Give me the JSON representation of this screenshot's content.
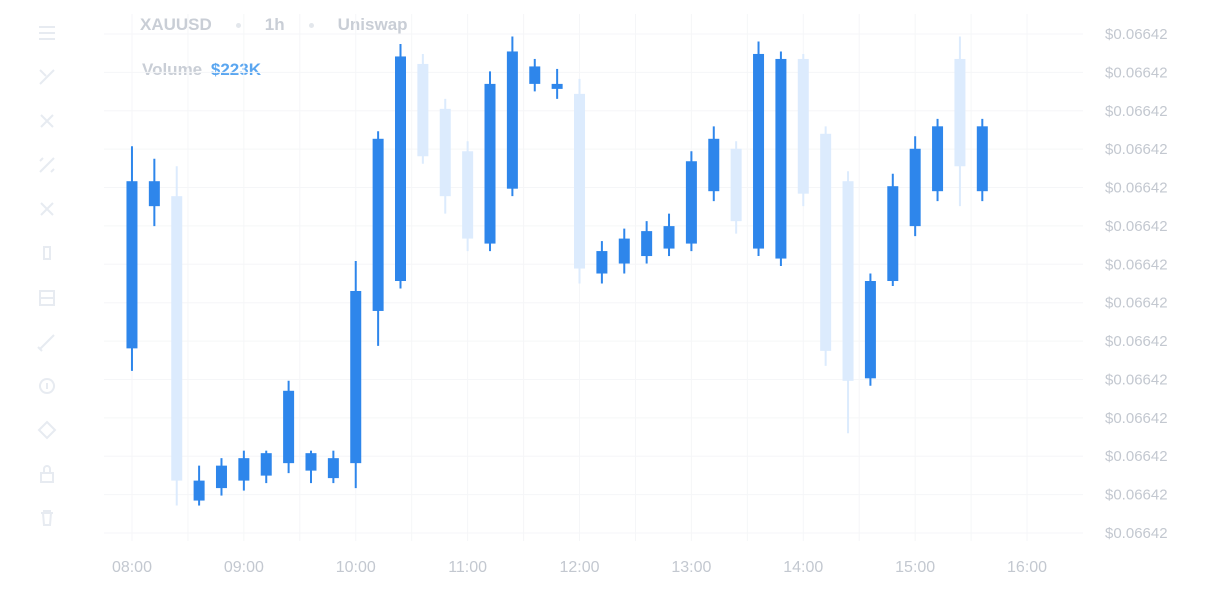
{
  "header": {
    "symbol": "XAUUSD",
    "interval": "1h",
    "exchange": "Uniswap"
  },
  "volume": {
    "label": "Volume",
    "value": "$223K"
  },
  "toolbar": {
    "icons": [
      "menu-icon",
      "cursor-icon",
      "crosshair-icon",
      "measure-icon",
      "fib-icon",
      "rectangle-icon",
      "text-icon",
      "pencil-icon",
      "magnet-icon",
      "brush-icon",
      "lock-icon",
      "trash-icon"
    ]
  },
  "colors": {
    "up": "#2e86eb",
    "down": "#dcebfd",
    "grid": "#f5f6f8",
    "label": "#c3c8d0"
  },
  "chart_data": {
    "type": "candlestick",
    "y_tick_labels": [
      "$0.06642",
      "$0.06642",
      "$0.06642",
      "$0.06642",
      "$0.06642",
      "$0.06642",
      "$0.06642",
      "$0.06642",
      "$0.06642",
      "$0.06642",
      "$0.06642",
      "$0.06642",
      "$0.06642",
      "$0.06642"
    ],
    "x_tick_labels": [
      "08:00",
      "09:00",
      "10:00",
      "11:00",
      "12:00",
      "13:00",
      "14:00",
      "15:00",
      "16:00"
    ],
    "x_range_hours": [
      7.75,
      16.5
    ],
    "y_range": [
      0,
      1
    ],
    "grid": true,
    "candles": [
      {
        "t": 8.0,
        "o": 0.37,
        "h": 0.775,
        "l": 0.325,
        "c": 0.705,
        "dir": "up"
      },
      {
        "t": 8.2,
        "o": 0.655,
        "h": 0.75,
        "l": 0.615,
        "c": 0.705,
        "dir": "up"
      },
      {
        "t": 8.4,
        "o": 0.675,
        "h": 0.735,
        "l": 0.055,
        "c": 0.105,
        "dir": "down"
      },
      {
        "t": 8.6,
        "o": 0.065,
        "h": 0.135,
        "l": 0.055,
        "c": 0.105,
        "dir": "up"
      },
      {
        "t": 8.8,
        "o": 0.09,
        "h": 0.15,
        "l": 0.075,
        "c": 0.135,
        "dir": "up"
      },
      {
        "t": 9.0,
        "o": 0.105,
        "h": 0.165,
        "l": 0.085,
        "c": 0.15,
        "dir": "up"
      },
      {
        "t": 9.2,
        "o": 0.115,
        "h": 0.165,
        "l": 0.1,
        "c": 0.16,
        "dir": "up"
      },
      {
        "t": 9.4,
        "o": 0.14,
        "h": 0.305,
        "l": 0.12,
        "c": 0.285,
        "dir": "up"
      },
      {
        "t": 9.6,
        "o": 0.125,
        "h": 0.165,
        "l": 0.1,
        "c": 0.16,
        "dir": "up"
      },
      {
        "t": 9.8,
        "o": 0.11,
        "h": 0.165,
        "l": 0.1,
        "c": 0.15,
        "dir": "up"
      },
      {
        "t": 10.0,
        "o": 0.14,
        "h": 0.545,
        "l": 0.09,
        "c": 0.485,
        "dir": "up"
      },
      {
        "t": 10.2,
        "o": 0.445,
        "h": 0.805,
        "l": 0.375,
        "c": 0.79,
        "dir": "up"
      },
      {
        "t": 10.4,
        "o": 0.505,
        "h": 0.98,
        "l": 0.49,
        "c": 0.955,
        "dir": "up"
      },
      {
        "t": 10.6,
        "o": 0.94,
        "h": 0.96,
        "l": 0.74,
        "c": 0.755,
        "dir": "down"
      },
      {
        "t": 10.8,
        "o": 0.85,
        "h": 0.87,
        "l": 0.64,
        "c": 0.675,
        "dir": "down"
      },
      {
        "t": 11.0,
        "o": 0.765,
        "h": 0.785,
        "l": 0.565,
        "c": 0.59,
        "dir": "down"
      },
      {
        "t": 11.2,
        "o": 0.58,
        "h": 0.925,
        "l": 0.565,
        "c": 0.9,
        "dir": "up"
      },
      {
        "t": 11.4,
        "o": 0.69,
        "h": 0.995,
        "l": 0.675,
        "c": 0.965,
        "dir": "up"
      },
      {
        "t": 11.6,
        "o": 0.9,
        "h": 0.95,
        "l": 0.885,
        "c": 0.935,
        "dir": "up"
      },
      {
        "t": 11.8,
        "o": 0.89,
        "h": 0.93,
        "l": 0.87,
        "c": 0.9,
        "dir": "up"
      },
      {
        "t": 12.0,
        "o": 0.88,
        "h": 0.91,
        "l": 0.5,
        "c": 0.53,
        "dir": "down"
      },
      {
        "t": 12.2,
        "o": 0.52,
        "h": 0.585,
        "l": 0.5,
        "c": 0.565,
        "dir": "up"
      },
      {
        "t": 12.4,
        "o": 0.54,
        "h": 0.61,
        "l": 0.52,
        "c": 0.59,
        "dir": "up"
      },
      {
        "t": 12.6,
        "o": 0.555,
        "h": 0.625,
        "l": 0.54,
        "c": 0.605,
        "dir": "up"
      },
      {
        "t": 12.8,
        "o": 0.57,
        "h": 0.64,
        "l": 0.555,
        "c": 0.615,
        "dir": "up"
      },
      {
        "t": 13.0,
        "o": 0.58,
        "h": 0.765,
        "l": 0.565,
        "c": 0.745,
        "dir": "up"
      },
      {
        "t": 13.2,
        "o": 0.685,
        "h": 0.815,
        "l": 0.665,
        "c": 0.79,
        "dir": "up"
      },
      {
        "t": 13.4,
        "o": 0.77,
        "h": 0.785,
        "l": 0.6,
        "c": 0.625,
        "dir": "down"
      },
      {
        "t": 13.6,
        "o": 0.57,
        "h": 0.985,
        "l": 0.555,
        "c": 0.96,
        "dir": "up"
      },
      {
        "t": 13.8,
        "o": 0.55,
        "h": 0.965,
        "l": 0.535,
        "c": 0.95,
        "dir": "up"
      },
      {
        "t": 14.0,
        "o": 0.95,
        "h": 0.96,
        "l": 0.655,
        "c": 0.68,
        "dir": "down"
      },
      {
        "t": 14.2,
        "o": 0.8,
        "h": 0.815,
        "l": 0.335,
        "c": 0.365,
        "dir": "down"
      },
      {
        "t": 14.4,
        "o": 0.705,
        "h": 0.725,
        "l": 0.2,
        "c": 0.305,
        "dir": "down"
      },
      {
        "t": 14.6,
        "o": 0.31,
        "h": 0.52,
        "l": 0.295,
        "c": 0.505,
        "dir": "up"
      },
      {
        "t": 14.8,
        "o": 0.505,
        "h": 0.72,
        "l": 0.495,
        "c": 0.695,
        "dir": "up"
      },
      {
        "t": 15.0,
        "o": 0.615,
        "h": 0.795,
        "l": 0.595,
        "c": 0.77,
        "dir": "up"
      },
      {
        "t": 15.2,
        "o": 0.685,
        "h": 0.83,
        "l": 0.665,
        "c": 0.815,
        "dir": "up"
      },
      {
        "t": 15.4,
        "o": 0.735,
        "h": 0.995,
        "l": 0.655,
        "c": 0.95,
        "dir": "down"
      },
      {
        "t": 15.6,
        "o": 0.685,
        "h": 0.83,
        "l": 0.665,
        "c": 0.815,
        "dir": "up"
      }
    ]
  }
}
